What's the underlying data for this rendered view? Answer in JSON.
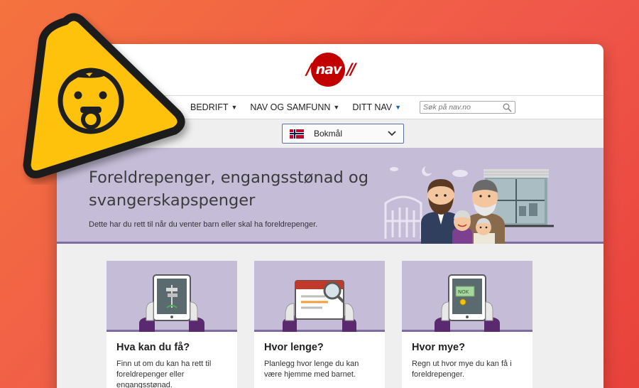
{
  "logo": {
    "text": "nav",
    "left_mark": "/",
    "right_mark": "//"
  },
  "menu": {
    "items": [
      {
        "label": "BEDRIFT",
        "caret": "▼"
      },
      {
        "label": "NAV OG SAMFUNN",
        "caret": "▼"
      },
      {
        "label": "DITT NAV",
        "caret": "▼"
      }
    ]
  },
  "search": {
    "placeholder": "Søk på nav.no"
  },
  "language": {
    "selected": "Bokmål"
  },
  "hero": {
    "title": "Foreldrepenger, engangsstønad og svangerskapspenger",
    "subtitle": "Dette har du rett til når du venter barn eller skal ha foreldrepenger."
  },
  "cards": [
    {
      "title": "Hva kan du få?",
      "text": "Finn ut om du kan ha rett til foreldrepenger eller engangsstønad."
    },
    {
      "title": "Hvor lenge?",
      "text": "Planlegg hvor lenge du kan være hjemme med barnet."
    },
    {
      "title": "Hvor mye?",
      "text": "Regn ut hvor mye du kan få i foreldrepenger.",
      "tag": "NOK"
    }
  ],
  "colors": {
    "background_start": "#f4733e",
    "background_end": "#e8423a",
    "nav_red": "#c30000",
    "hero_purple": "#c5bdd8",
    "accent_purple": "#7d6c9f",
    "warning_yellow": "#fec20f"
  },
  "icons": {
    "warning": "baby-warning-icon",
    "search": "search-icon",
    "flag": "norway-flag-icon",
    "dropdown": "chevron-down-icon"
  }
}
